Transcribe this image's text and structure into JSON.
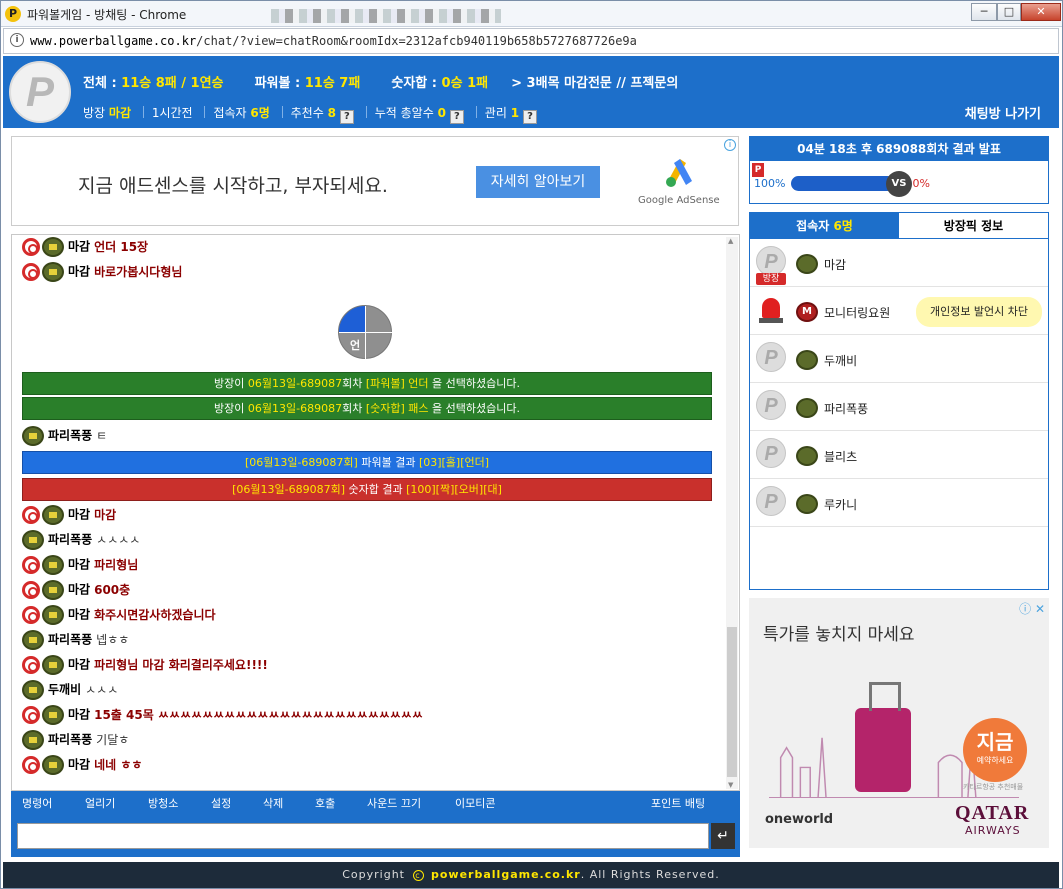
{
  "window": {
    "title": "파워볼게임 - 방채팅 - Chrome",
    "url_host": "www.powerballgame.co.kr",
    "url_path": "/chat/?view=chatRoom&roomIdx=2312afcb940119b658b5727687726e9a",
    "min_label": "─",
    "max_label": "□",
    "close_label": "✕"
  },
  "header": {
    "logo_letter": "P",
    "total_label": "전체 : ",
    "total_value": "11승 8패 / 1연승",
    "powerball_label": "파워볼 : ",
    "powerball_value": "11승 7패",
    "sum_label": "숫자합 : ",
    "sum_value": "0승 1패",
    "room_title": "> 3배목 마감전문 // 프젝문의",
    "owner_label": "방장",
    "owner_name": "마감",
    "interval": "1시간전",
    "users_label": "접속자",
    "users_value": "6명",
    "recommend_label": "추천수",
    "recommend_value": "8",
    "winnings_label": "누적 총알수",
    "winnings_value": "0",
    "manage_label": "관리",
    "manage_value": "1",
    "help": "?",
    "exit_label": "채팅방 나가기"
  },
  "ad_banner": {
    "text": "지금 애드센스를 시작하고, 부자되세요.",
    "button": "자세히 알아보기",
    "brand": "Google AdSense",
    "info": "i"
  },
  "chat": {
    "messages": [
      {
        "type": "user",
        "role": "owner",
        "nick": "마감",
        "text": "언더 15장"
      },
      {
        "type": "user",
        "role": "owner",
        "nick": "마감",
        "text": "바로가봅시다형님"
      },
      {
        "type": "pie",
        "label": "언"
      },
      {
        "type": "notice",
        "color": "g",
        "pre": "방장이 ",
        "hl1": "06월13일-689087",
        "mid": "회차 ",
        "hl2": "[파워볼] 언더",
        "post": " 을 선택하셨습니다."
      },
      {
        "type": "notice",
        "color": "g",
        "pre": "방장이 ",
        "hl1": "06월13일-689087",
        "mid": "회차 ",
        "hl2": "[숫자합] 패스",
        "post": " 을 선택하셨습니다."
      },
      {
        "type": "user",
        "role": "member",
        "nick": "파리폭풍",
        "text": "ㅌ"
      },
      {
        "type": "notice",
        "color": "b",
        "pre": "",
        "hl1": "[06월13일-689087회]",
        "mid": " 파워볼 결과 ",
        "hl2": "[03][홀][언더]",
        "post": ""
      },
      {
        "type": "notice",
        "color": "r",
        "pre": "",
        "hl1": "[06월13일-689087회]",
        "mid": " 숫자합 결과 ",
        "hl2": "[100][짝][오버][대]",
        "post": ""
      },
      {
        "type": "user",
        "role": "owner",
        "nick": "마감",
        "text": "마감"
      },
      {
        "type": "user",
        "role": "member",
        "nick": "파리폭풍",
        "text": "ㅅㅅㅅㅅ"
      },
      {
        "type": "user",
        "role": "owner",
        "nick": "마감",
        "text": "파리형님"
      },
      {
        "type": "user",
        "role": "owner",
        "nick": "마감",
        "text": "600충"
      },
      {
        "type": "user",
        "role": "owner",
        "nick": "마감",
        "text": "화주시면감사하겠습니다"
      },
      {
        "type": "user",
        "role": "member",
        "nick": "파리폭풍",
        "text": "넵ㅎㅎ"
      },
      {
        "type": "user",
        "role": "owner",
        "nick": "마감",
        "text": "파리형님 마감 화리결리주세요!!!!"
      },
      {
        "type": "user",
        "role": "member",
        "nick": "두깨비",
        "text": "ㅅㅅㅅ"
      },
      {
        "type": "user",
        "role": "owner",
        "nick": "마감",
        "text": "15출 45목 ㅆㅆㅆㅆㅆㅆㅆㅆㅆㅆㅆㅆㅆㅆㅆㅆㅆㅆㅆㅆㅆㅆㅆㅆ"
      },
      {
        "type": "user",
        "role": "member",
        "nick": "파리폭풍",
        "text": "기달ㅎ"
      },
      {
        "type": "user",
        "role": "owner",
        "nick": "마감",
        "text": "네네 ㅎㅎ"
      }
    ]
  },
  "toolbar": {
    "items": [
      "명령어",
      "얼리기",
      "방청소",
      "설정",
      "삭제",
      "호출",
      "사운드 끄기",
      "이모티콘"
    ],
    "point_bet": "포인트 배팅",
    "enter": "↵",
    "input_value": ""
  },
  "result": {
    "title": "04분 18초 후 689088회차 결과 발표",
    "flag": "P",
    "left_pct": "100%",
    "right_pct": "0%",
    "vs": "VS"
  },
  "users_panel": {
    "tab_users_label": "접속자",
    "tab_users_value": "6명",
    "tab_owner_info": "방장픽 정보",
    "owner_badge": "방장",
    "monitor_bubble": "개인정보 발언시 차단",
    "users": [
      {
        "name": "마감",
        "kind": "owner"
      },
      {
        "name": "모니터링요원",
        "kind": "monitor"
      },
      {
        "name": "두깨비",
        "kind": "member"
      },
      {
        "name": "파리폭풍",
        "kind": "member"
      },
      {
        "name": "블리츠",
        "kind": "member"
      },
      {
        "name": "루카니",
        "kind": "member"
      }
    ]
  },
  "ad_side": {
    "title": "특가를 놓치지 마세요",
    "icons": "ⓘ ✕",
    "circle_big": "지금",
    "circle_small": "예약하세요",
    "note": "카타르항공 추천매물",
    "oneworld": "oneworld",
    "qatar": "QATAR",
    "airways": "AIRWAYS"
  },
  "footer": {
    "prefix": "Copyright",
    "c": "c",
    "site": "powerballgame.co.kr",
    "suffix": ". All Rights Reserved."
  }
}
